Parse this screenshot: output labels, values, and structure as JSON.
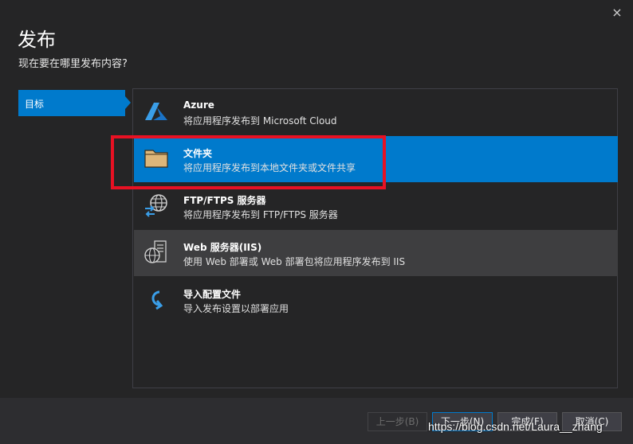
{
  "dialog": {
    "title": "发布",
    "subtitle": "现在要在哪里发布内容?",
    "close_icon": "×"
  },
  "sidebar": {
    "items": [
      {
        "label": "目标",
        "selected": true
      }
    ]
  },
  "options": [
    {
      "icon": "azure-icon",
      "title": "Azure",
      "desc": "将应用程序发布到 Microsoft Cloud",
      "state": "normal"
    },
    {
      "icon": "folder-icon",
      "title": "文件夹",
      "desc": "将应用程序发布到本地文件夹或文件共享",
      "state": "selected"
    },
    {
      "icon": "ftp-globe-icon",
      "title": "FTP/FTPS 服务器",
      "desc": "将应用程序发布到 FTP/FTPS 服务器",
      "state": "normal"
    },
    {
      "icon": "web-server-icon",
      "title": "Web 服务器(IIS)",
      "desc": "使用 Web 部署或 Web 部署包将应用程序发布到 IIS",
      "state": "hover"
    },
    {
      "icon": "import-profile-icon",
      "title": "导入配置文件",
      "desc": "导入发布设置以部署应用",
      "state": "normal"
    }
  ],
  "buttons": {
    "back": "上一步(B)",
    "next": "下一步(N)",
    "finish": "完成(F)",
    "cancel": "取消(C)"
  },
  "watermark": "https://blog.csdn.net/Laura__zhang",
  "colors": {
    "accent": "#007acc",
    "background": "#252526",
    "highlight_border": "#e81123"
  }
}
